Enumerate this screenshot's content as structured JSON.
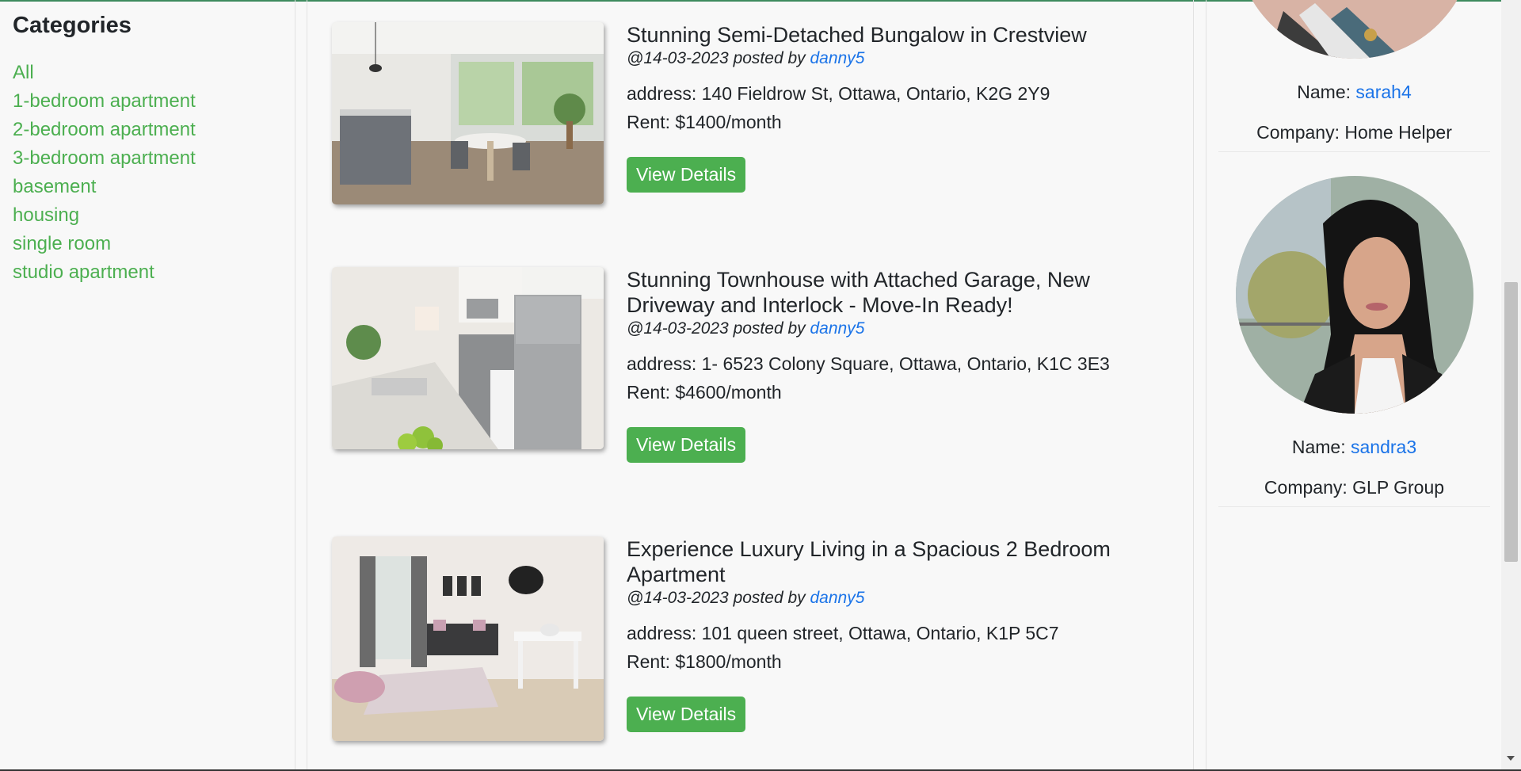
{
  "sidebar": {
    "heading": "Categories",
    "items": [
      {
        "label": "All"
      },
      {
        "label": "1-bedroom apartment"
      },
      {
        "label": "2-bedroom apartment"
      },
      {
        "label": "3-bedroom apartment"
      },
      {
        "label": "basement"
      },
      {
        "label": "housing"
      },
      {
        "label": "single room"
      },
      {
        "label": "studio apartment"
      }
    ]
  },
  "listings": [
    {
      "title": "Stunning Semi-Detached Bungalow in Crestview",
      "date": "@14-03-2023 posted by",
      "author": "danny5",
      "address": "address: 140 Fieldrow St, Ottawa, Ontario, K2G 2Y9",
      "rent": "Rent: $1400/month",
      "button": "View Details"
    },
    {
      "title": "Stunning Townhouse with Attached Garage, New Driveway and Interlock - Move-In Ready!",
      "date": "@14-03-2023 posted by",
      "author": "danny5",
      "address": "address: 1- 6523 Colony Square, Ottawa, Ontario, K1C 3E3",
      "rent": "Rent: $4600/month",
      "button": "View Details"
    },
    {
      "title": "Experience Luxury Living in a Spacious 2 Bedroom Apartment",
      "date": "@14-03-2023 posted by",
      "author": "danny5",
      "address": "address: 101 queen street, Ottawa, Ontario, K1P 5C7",
      "rent": "Rent: $1800/month",
      "button": "View Details"
    }
  ],
  "agents": [
    {
      "name_label": "Name:",
      "name": "sarah4",
      "company": "Company: Home Helper"
    },
    {
      "name_label": "Name:",
      "name": "sandra3",
      "company": "Company: GLP Group"
    }
  ],
  "colors": {
    "accent": "#4caf50",
    "link": "#1a73e8"
  }
}
